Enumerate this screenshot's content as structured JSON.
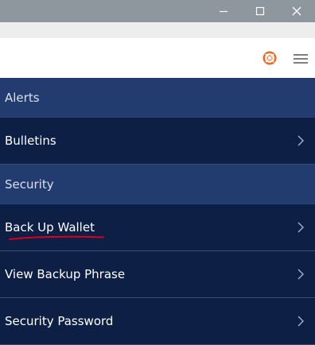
{
  "window": {
    "controls": [
      {
        "id": "minimize",
        "icon": "minimize-icon"
      },
      {
        "id": "maximize",
        "icon": "maximize-icon"
      },
      {
        "id": "close",
        "icon": "close-icon"
      }
    ]
  },
  "appbar": {
    "icons": [
      "lifebuoy-icon",
      "hamburger-menu-icon"
    ],
    "accent": "#f26b21"
  },
  "list": {
    "sections": [
      {
        "header": "Alerts",
        "items": [
          {
            "label": "Bulletins"
          }
        ]
      },
      {
        "header": "Security",
        "items": [
          {
            "label": "Back Up Wallet",
            "annotated_underline": true
          },
          {
            "label": "View Backup Phrase"
          },
          {
            "label": "Security Password"
          }
        ]
      }
    ]
  },
  "colors": {
    "titlebar": "#8e969e",
    "section_header": "#233c6f",
    "row_bg": "#0d1f44",
    "annotation": "#d9001b"
  }
}
